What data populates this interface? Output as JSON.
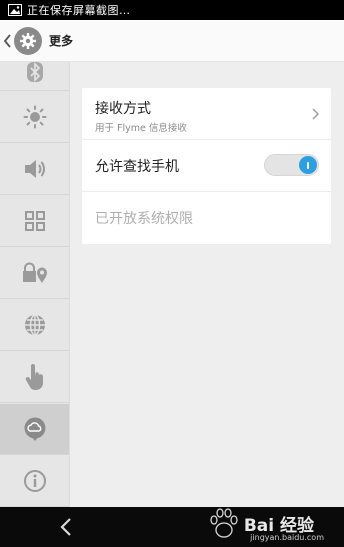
{
  "status_bar": {
    "notification_text": "正在保存屏幕截图…",
    "icon": "image-icon"
  },
  "header": {
    "back_icon": "chevron-left-icon",
    "app_icon": "gear-icon",
    "title": "更多"
  },
  "sidebar": {
    "items": [
      {
        "icon": "bluetooth-icon",
        "active": false
      },
      {
        "icon": "brightness-icon",
        "active": false
      },
      {
        "icon": "volume-icon",
        "active": false
      },
      {
        "icon": "apps-grid-icon",
        "active": false
      },
      {
        "icon": "lock-location-icon",
        "active": false
      },
      {
        "icon": "globe-icon",
        "active": false
      },
      {
        "icon": "hand-pointer-icon",
        "active": false
      },
      {
        "icon": "cloud-chat-icon",
        "active": true
      },
      {
        "icon": "info-icon",
        "active": false
      }
    ]
  },
  "settings": {
    "receive_method": {
      "title": "接收方式",
      "subtitle": "用于 Flyme 信息接收"
    },
    "find_phone": {
      "title": "允许查找手机",
      "enabled": true
    },
    "system_permission": {
      "title": "已开放系统权限"
    }
  },
  "navigation": {
    "back_icon": "back-arrow-icon"
  },
  "watermark": {
    "brand": "Bai 经验",
    "url": "jingyan.baidu.com"
  },
  "colors": {
    "accent": "#2d9fe0",
    "sidebar_bg": "#e6e6e6",
    "sidebar_active": "#cfcfcf",
    "content_bg": "#eeeeee",
    "card_bg": "#ffffff",
    "disabled_text": "#b0b0b0"
  }
}
